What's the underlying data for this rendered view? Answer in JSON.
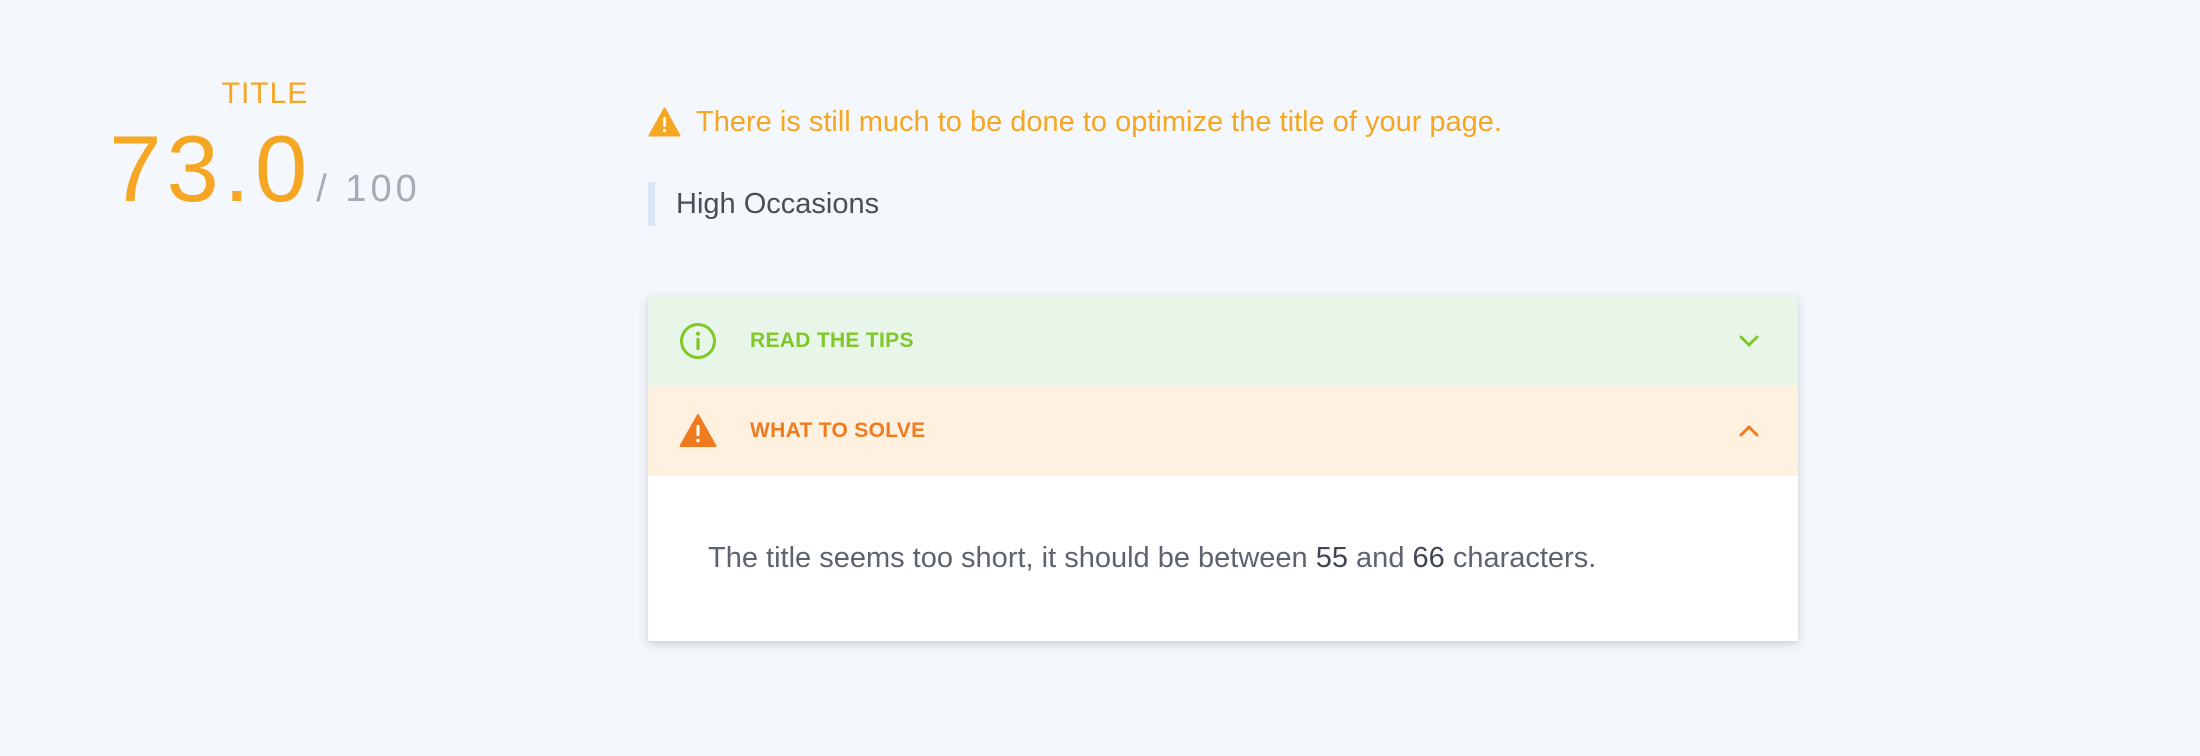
{
  "score": {
    "label": "TITLE",
    "value": "73.0",
    "max": "/ 100"
  },
  "alert": {
    "icon": "warning-triangle-icon",
    "text": "There is still much to be done to optimize the title of your page."
  },
  "page_title_value": "High Occasions",
  "accordion": {
    "tips": {
      "icon": "info-circle-icon",
      "label": "READ THE TIPS",
      "state": "collapsed"
    },
    "solve": {
      "icon": "warning-triangle-icon",
      "label": "WHAT TO SOLVE",
      "state": "expanded",
      "message": {
        "before": "The title seems too short, it should be between ",
        "min": "55",
        "middle": " and ",
        "max": "66",
        "after": " characters."
      }
    }
  },
  "colors": {
    "background": "#f4f7fb",
    "score_orange": "#f5a623",
    "tips_green": "#7ec827",
    "tips_bg": "#e8f6e9",
    "solve_orange": "#f07b1f",
    "solve_bg": "#fff1df"
  }
}
